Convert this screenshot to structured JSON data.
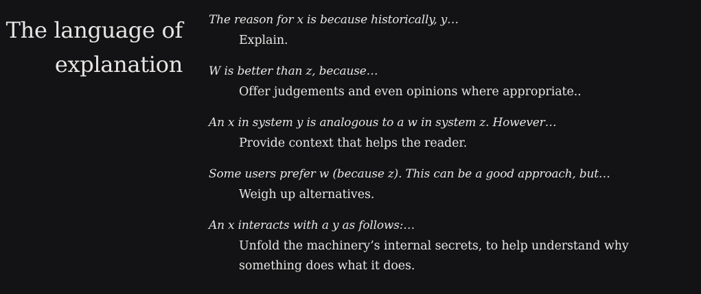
{
  "heading": "The language of explanation",
  "items": [
    {
      "term": "The reason for x is because historically, y…",
      "description": "Explain."
    },
    {
      "term": "W is better than z, because…",
      "description": "Offer judgements and even opinions where appropriate.."
    },
    {
      "term": "An x in system y is analogous to a w in system z. However…",
      "description": "Provide context that helps the reader."
    },
    {
      "term": "Some users prefer w (because z). This can be a good approach, but…",
      "description": "Weigh up alternatives."
    },
    {
      "term": "An x interacts with a y as follows:…",
      "description": "Unfold the machinery’s internal secrets, to help understand why something does what it does."
    }
  ]
}
